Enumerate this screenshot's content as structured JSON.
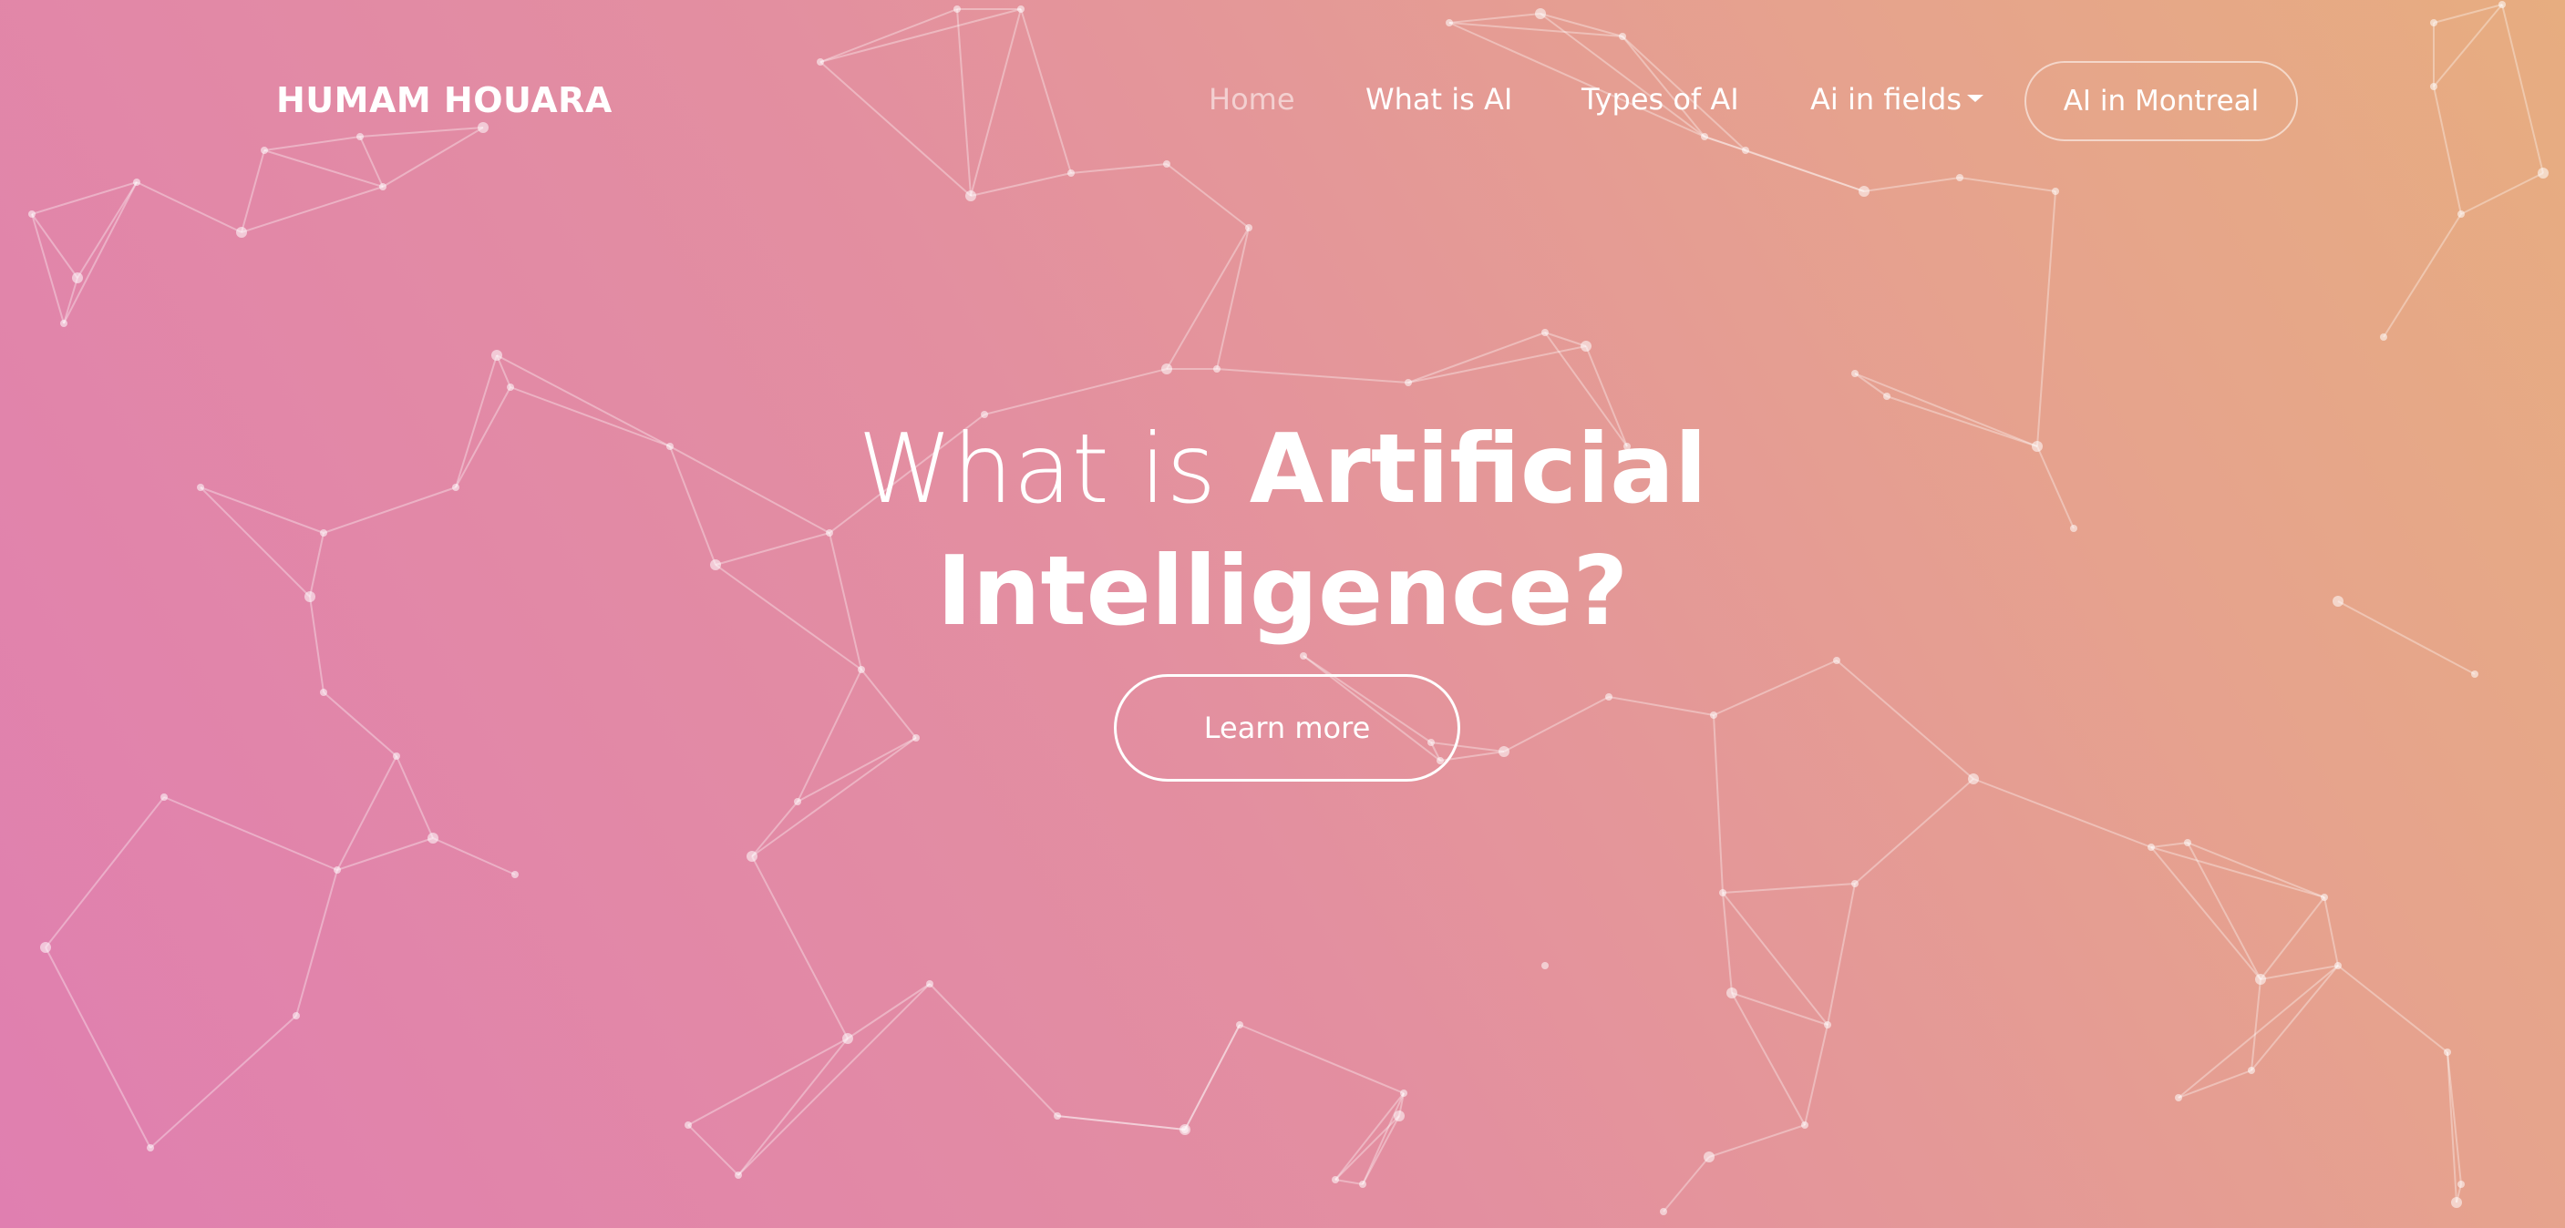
{
  "brand": {
    "name": "HUMAM HOUARA"
  },
  "nav": {
    "items": [
      {
        "label": "Home",
        "active": true
      },
      {
        "label": "What is AI",
        "active": false
      },
      {
        "label": "Types of AI",
        "active": false
      },
      {
        "label": "Ai in fields",
        "active": false,
        "dropdown": true
      }
    ],
    "cta_label": "AI in Montreal"
  },
  "hero": {
    "title_light": "What is",
    "title_bold_1": "Artificial",
    "title_bold_2": "Intelligence?",
    "button_label": "Learn more"
  },
  "colors": {
    "gradient_pink": "#e07fb0",
    "gradient_peach": "#e7ad80",
    "text": "#ffffff"
  }
}
